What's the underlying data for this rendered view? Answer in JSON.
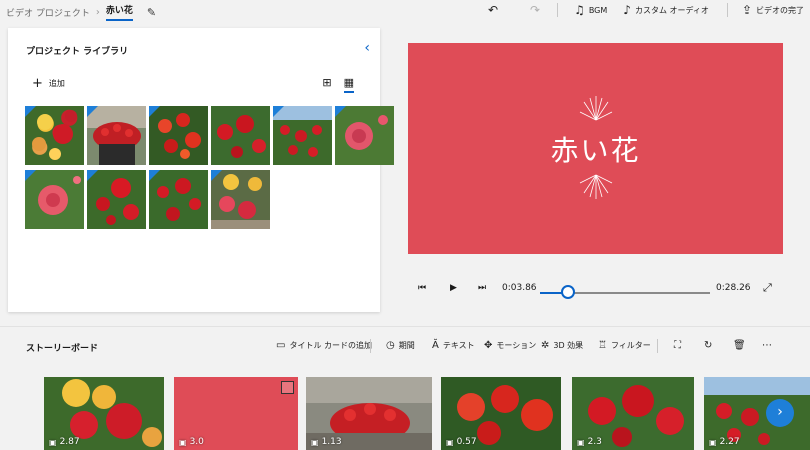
{
  "breadcrumb": {
    "root": "ビデオ プロジェクト",
    "current": "赤い花"
  },
  "toolbar": {
    "bgm_label": "BGM",
    "custom_audio_label": "カスタム オーディオ",
    "finish_label": "ビデオの完了"
  },
  "library": {
    "title": "プロジェクト ライブラリ",
    "add_label": "追加"
  },
  "preview": {
    "title_text": "赤い花",
    "background": "#df4c57",
    "current_time": "0:03.86",
    "total_time": "0:28.26",
    "progress": 0.137
  },
  "storyboard": {
    "title": "ストーリーボード",
    "tools": {
      "title_card": "タイトル カードの追加",
      "duration": "期間",
      "text": "テキスト",
      "motion": "モーション",
      "effects": "3D 効果",
      "filter": "フィルター"
    },
    "clips": [
      {
        "duration": "2.87",
        "kind": "photo"
      },
      {
        "duration": "3.0",
        "kind": "title-card"
      },
      {
        "duration": "1.13",
        "kind": "photo"
      },
      {
        "duration": "0.57",
        "kind": "photo"
      },
      {
        "duration": "2.3",
        "kind": "photo"
      },
      {
        "duration": "2.27",
        "kind": "photo"
      }
    ]
  },
  "colors": {
    "accent": "#0a64c8",
    "title_card": "#df4c57"
  }
}
